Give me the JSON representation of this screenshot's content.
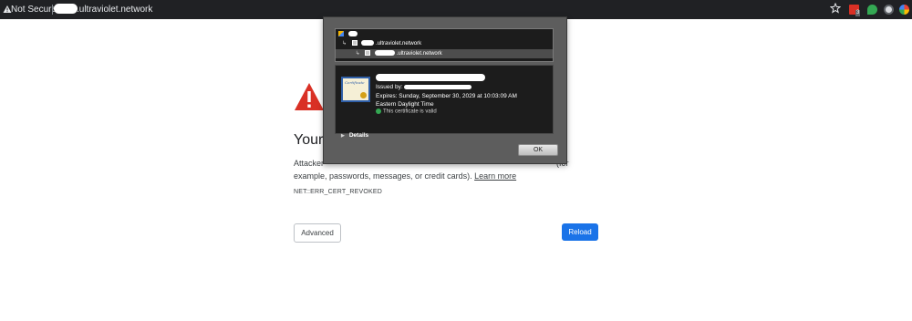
{
  "browser": {
    "security_label": "Not Secure",
    "domain": ".ultraviolet.network",
    "extension_badge": "3"
  },
  "error_page": {
    "heading": "Your c",
    "description_start": "Attacker",
    "description_end": "(for",
    "description_line2": "example, passwords, messages, or credit cards).",
    "learn_more": "Learn more",
    "error_code": "NET::ERR_CERT_REVOKED",
    "advanced_button": "Advanced",
    "reload_button": "Reload"
  },
  "certificate_sheet": {
    "chain": {
      "intermediate_label": ".ultraviolet.network",
      "leaf_label": ".ultraviolet.network"
    },
    "issued_by_label": "Issued by:",
    "expires": "Expires: Sunday, September 30, 2029 at 10:03:09 AM Eastern Daylight Time",
    "status": "This certificate is valid",
    "details_label": "Details",
    "ok_button": "OK"
  },
  "icon_text": {
    "cert_title": "Certificate"
  },
  "colors": {
    "toolbar_bg": "#202124",
    "error_red": "#d93025",
    "reload_blue": "#1a73e8",
    "valid_green": "#34a853"
  }
}
